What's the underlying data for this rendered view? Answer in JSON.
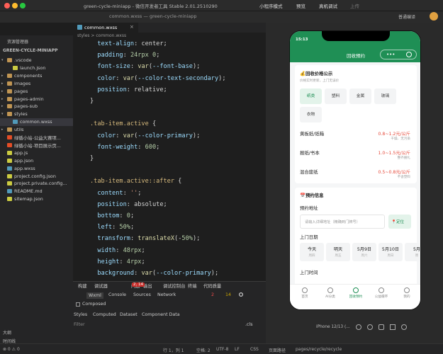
{
  "titlebar": {
    "title": "green-cycle-miniapp - 微信开发者工具 Stable 2.01.2510290",
    "mode": "小程序模式",
    "preview": "预览",
    "remote_debug": "真机调试",
    "upload": "上传",
    "compile_mode": "普通编译"
  },
  "window_subtitle": "common.wxss — green-cycle-miniapp",
  "explorer": {
    "header": "资源管理器",
    "project": "GREEN-CYCLE-MINIAPP",
    "items": [
      {
        "label": ".vscode",
        "type": "folder",
        "depth": 1,
        "open": true
      },
      {
        "label": "launch.json",
        "type": "json",
        "depth": 2
      },
      {
        "label": "components",
        "type": "folder",
        "depth": 1
      },
      {
        "label": "images",
        "type": "folder",
        "depth": 1
      },
      {
        "label": "pages",
        "type": "folder",
        "depth": 1
      },
      {
        "label": "pages-admin",
        "type": "folder",
        "depth": 1
      },
      {
        "label": "pages-sub",
        "type": "folder",
        "depth": 1
      },
      {
        "label": "styles",
        "type": "folder",
        "depth": 1,
        "open": true
      },
      {
        "label": "common.wxss",
        "type": "wxss",
        "depth": 2,
        "selected": true
      },
      {
        "label": "utils",
        "type": "folder",
        "depth": 1
      },
      {
        "label": "绿循小站-公益大赛项...",
        "type": "html",
        "depth": 1
      },
      {
        "label": "绿循小站-项目展示页...",
        "type": "html",
        "depth": 1
      },
      {
        "label": "app.js",
        "type": "js",
        "depth": 1
      },
      {
        "label": "app.json",
        "type": "json",
        "depth": 1
      },
      {
        "label": "app.wxss",
        "type": "wxss",
        "depth": 1
      },
      {
        "label": "project.config.json",
        "type": "json",
        "depth": 1
      },
      {
        "label": "project.private.config...",
        "type": "json",
        "depth": 1
      },
      {
        "label": "README.md",
        "type": "md",
        "depth": 1
      },
      {
        "label": "sitemap.json",
        "type": "json",
        "depth": 1
      }
    ],
    "outline": "大纲",
    "timeline": "时间线"
  },
  "editor": {
    "tab": "common.wxss",
    "breadcrumb": "styles > common.wxss",
    "lines": [
      "  text-align: center;",
      "  padding: 24rpx 0;",
      "  font-size: var(--font-base);",
      "  color: var(--color-text-secondary);",
      "  position: relative;",
      "}",
      "",
      ".tab-item.active {",
      "  color: var(--color-primary);",
      "  font-weight: 600;",
      "}",
      "",
      ".tab-item.active::after {",
      "  content: '';",
      "  position: absolute;",
      "  bottom: 0;",
      "  left: 50%;",
      "  transform: translateX(-50%);",
      "  width: 48rpx;",
      "  height: 4rpx;",
      "  background: var(--color-primary);"
    ]
  },
  "devtools": {
    "tabs": [
      "构建",
      "调试器",
      "问题",
      "输出",
      "调试控制台",
      "终端",
      "代码质量"
    ],
    "badge": "2, 14",
    "subtabs": [
      "Wxml",
      "Console",
      "Sources",
      "Network"
    ],
    "errors": "2",
    "warnings": "14",
    "composed": "Composed",
    "style_tabs": [
      "Styles",
      "Computed",
      "Dataset",
      "Component Data"
    ],
    "filter": "Filter",
    "cls": ".cls"
  },
  "statusbar": {
    "position": "行 1，列 1",
    "spaces": "空格: 2",
    "encoding": "UTF-8",
    "eol": "LF",
    "lang": "CSS",
    "page_path_label": "页面路径",
    "page_path": "pages/recycle/recycle"
  },
  "simulator": {
    "device": "iPhone 12/13 (...",
    "time": "15:13",
    "page_title": "回收预约",
    "price_section": {
      "title": "💰回收价格公示",
      "subtitle": "价格实时更新，上门无误价",
      "categories": [
        "纸类",
        "塑料",
        "金属",
        "玻璃",
        "衣物"
      ],
      "active_category": "纸类",
      "rows": [
        {
          "name": "黄板纸/纸箱",
          "price": "0.8~1.2元/公斤",
          "note": "干燥、无污染"
        },
        {
          "name": "报纸/书本",
          "price": "1.0~1.5元/公斤",
          "note": "整齐捆扎"
        },
        {
          "name": "混合废纸",
          "price": "0.5~0.8元/公斤",
          "note": "不含塑料"
        }
      ]
    },
    "booking": {
      "title": "📅预约信息",
      "address_label": "预约地址",
      "address_placeholder": "请输入详细地址（精确到门牌号）",
      "locate_button": "📍定位",
      "date_label": "上门日期",
      "dates": [
        {
          "main": "今天",
          "sub": "周四"
        },
        {
          "main": "明天",
          "sub": "周五"
        },
        {
          "main": "5月9日",
          "sub": "周六"
        },
        {
          "main": "5月10日",
          "sub": "周日"
        },
        {
          "main": "5月",
          "sub": "周"
        }
      ],
      "time_label": "上门时间"
    },
    "tabbar": [
      "首页",
      "AI分类",
      "回收预约",
      "公益循环",
      "我的"
    ]
  }
}
